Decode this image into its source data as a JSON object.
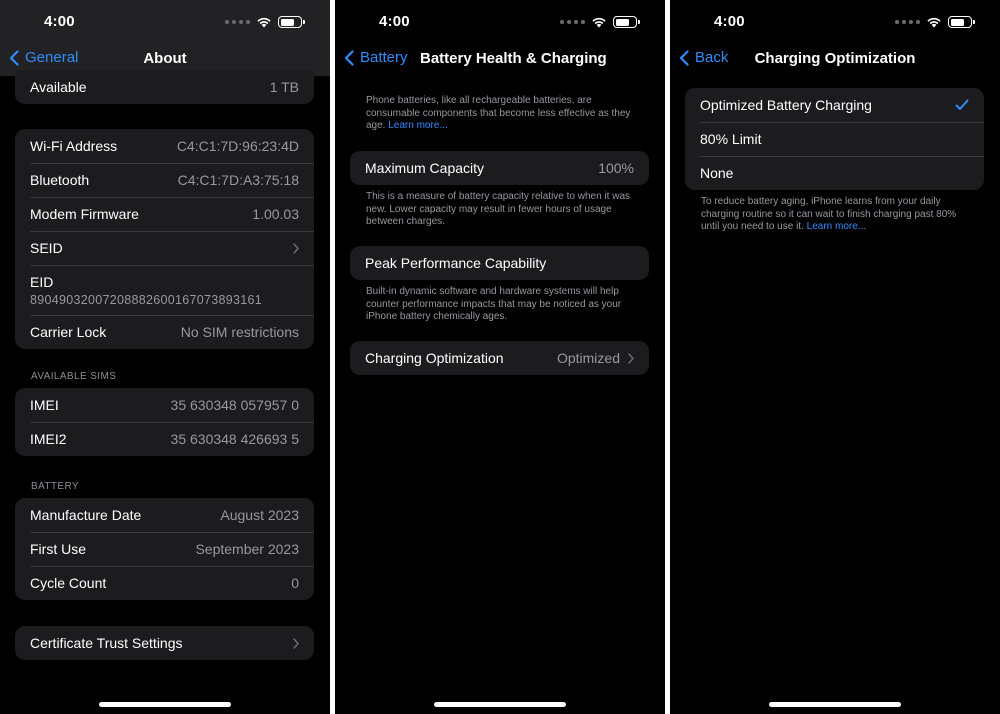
{
  "status": {
    "time": "4:00"
  },
  "about": {
    "back_label": "General",
    "title": "About",
    "partial_row": {
      "label": "Available",
      "value": "1 TB"
    },
    "network_rows": [
      {
        "label": "Wi-Fi Address",
        "value": "C4:C1:7D:96:23:4D"
      },
      {
        "label": "Bluetooth",
        "value": "C4:C1:7D:A3:75:18"
      },
      {
        "label": "Modem Firmware",
        "value": "1.00.03"
      },
      {
        "label": "SEID",
        "value": ""
      },
      {
        "label": "EID",
        "value": "89049032007208882600167073893161"
      },
      {
        "label": "Carrier Lock",
        "value": "No SIM restrictions"
      }
    ],
    "sims_header": "AVAILABLE SIMS",
    "sims": [
      {
        "label": "IMEI",
        "value": "35 630348 057957 0"
      },
      {
        "label": "IMEI2",
        "value": "35 630348 426693 5"
      }
    ],
    "battery_header": "BATTERY",
    "battery": [
      {
        "label": "Manufacture Date",
        "value": "August 2023"
      },
      {
        "label": "First Use",
        "value": "September 2023"
      },
      {
        "label": "Cycle Count",
        "value": "0"
      }
    ],
    "cert": {
      "label": "Certificate Trust Settings"
    }
  },
  "health": {
    "back_label": "Battery",
    "title": "Battery Health & Charging",
    "intro": "Phone batteries, like all rechargeable batteries, are consumable components that become less effective as they age.",
    "intro_link": "Learn more...",
    "max_capacity": {
      "label": "Maximum Capacity",
      "value": "100%"
    },
    "max_desc": "This is a measure of battery capacity relative to when it was new. Lower capacity may result in fewer hours of usage between charges.",
    "peak": {
      "label": "Peak Performance Capability"
    },
    "peak_desc": "Built-in dynamic software and hardware systems will help counter performance impacts that may be noticed as your iPhone battery chemically ages.",
    "charging": {
      "label": "Charging Optimization",
      "value": "Optimized"
    }
  },
  "optimization": {
    "back_label": "Back",
    "title": "Charging Optimization",
    "options": [
      {
        "label": "Optimized Battery Charging",
        "selected": true
      },
      {
        "label": "80% Limit",
        "selected": false
      },
      {
        "label": "None",
        "selected": false
      }
    ],
    "desc": "To reduce battery aging, iPhone learns from your daily charging routine so it can wait to finish charging past 80% until you need to use it.",
    "desc_link": "Learn more..."
  },
  "colors": {
    "accent": "#2f8cff",
    "cell": "#1c1c1e",
    "separator": "#38383a",
    "secondary": "#98989e"
  }
}
